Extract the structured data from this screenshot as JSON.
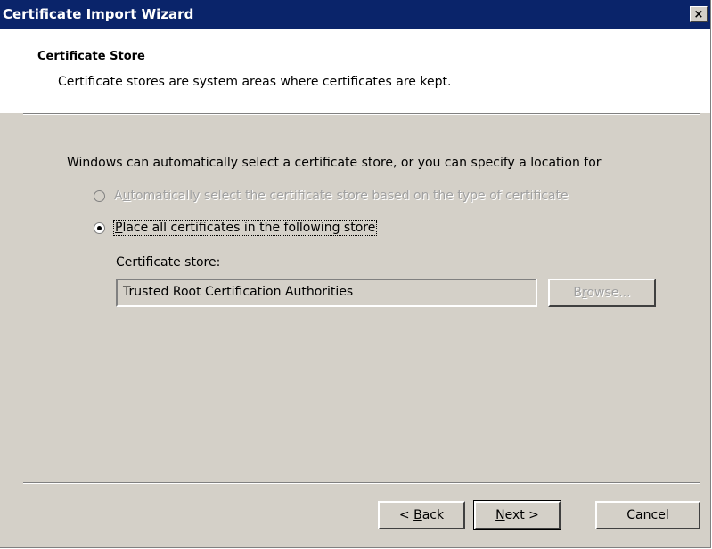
{
  "window": {
    "title": "Certificate Import Wizard",
    "close_glyph": "×"
  },
  "header": {
    "title": "Certificate Store",
    "subtitle": "Certificate stores are system areas where certificates are kept."
  },
  "body": {
    "intro": "Windows can automatically select a certificate store, or you can specify a location for",
    "options": [
      {
        "label_pre": "A",
        "label_u": "u",
        "label_post": "tomatically select the certificate store based on the type of certificate",
        "selected": false,
        "enabled": false
      },
      {
        "label_pre": "",
        "label_u": "P",
        "label_post": "lace all certificates in the following store",
        "selected": true,
        "enabled": true
      }
    ],
    "store_label": "Certificate store:",
    "store_value": "Trusted Root Certification Authorities",
    "browse": {
      "pre": "B",
      "u": "r",
      "post": "owse...",
      "enabled": false
    }
  },
  "footer": {
    "back": {
      "pre": "< ",
      "u": "B",
      "post": "ack"
    },
    "next": {
      "pre": "",
      "u": "N",
      "post": "ext >"
    },
    "cancel": "Cancel"
  }
}
